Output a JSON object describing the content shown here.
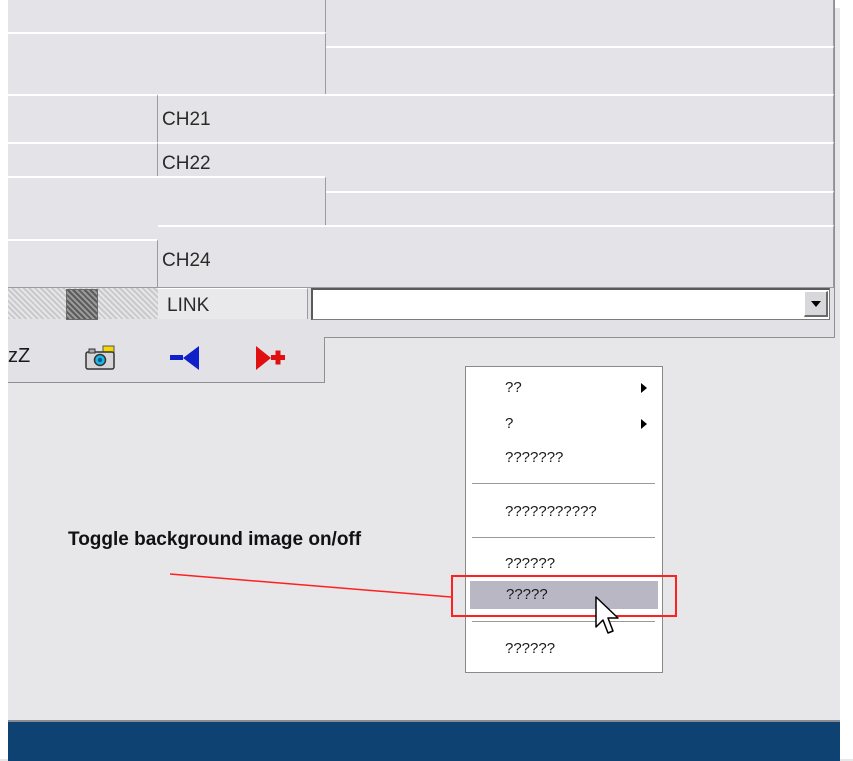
{
  "channels": {
    "ch21": "CH21",
    "ch22": "CH22",
    "ch24": "CH24",
    "link": "LINK"
  },
  "link_input": {
    "value": ""
  },
  "toolbar": {
    "sleep_label": "zZ"
  },
  "context_menu": {
    "items": [
      {
        "label": "??",
        "submenu": true
      },
      {
        "label": "?",
        "submenu": true
      },
      {
        "label": "???????"
      },
      {
        "label": "???????????"
      },
      {
        "label": "??????"
      },
      {
        "label": "?????",
        "highlighted": true
      },
      {
        "label": "??????"
      }
    ]
  },
  "annotation": {
    "text": "Toggle background image on/off",
    "color": "#ff2020"
  },
  "colors": {
    "taskbar": "#0d4272",
    "menu_highlight": "#b9b7c4"
  }
}
